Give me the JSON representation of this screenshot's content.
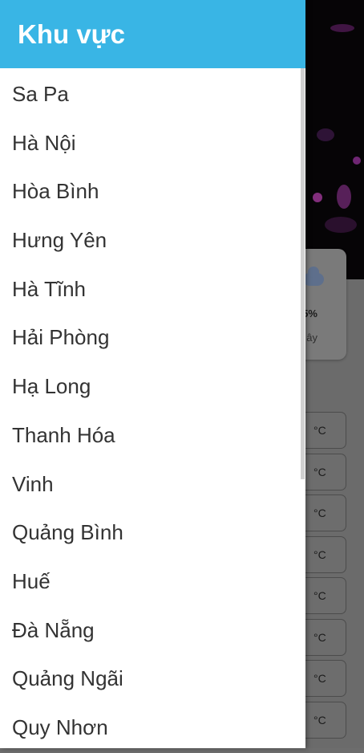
{
  "drawer": {
    "title": "Khu vực",
    "regions": [
      "Sa Pa",
      "Hà Nội",
      "Hòa Bình",
      "Hưng Yên",
      "Hà Tĩnh",
      "Hải Phòng",
      "Hạ Long",
      "Thanh Hóa",
      "Vinh",
      "Quảng Bình",
      "Huế",
      "Đà Nẵng",
      "Quảng Ngãi",
      "Quy Nhơn"
    ]
  },
  "background": {
    "card_percent": "5%",
    "card_sub": "ây",
    "temp_unit": "°C"
  },
  "colors": {
    "header": "#39b5e5",
    "overlay": "#6d6d6d"
  }
}
